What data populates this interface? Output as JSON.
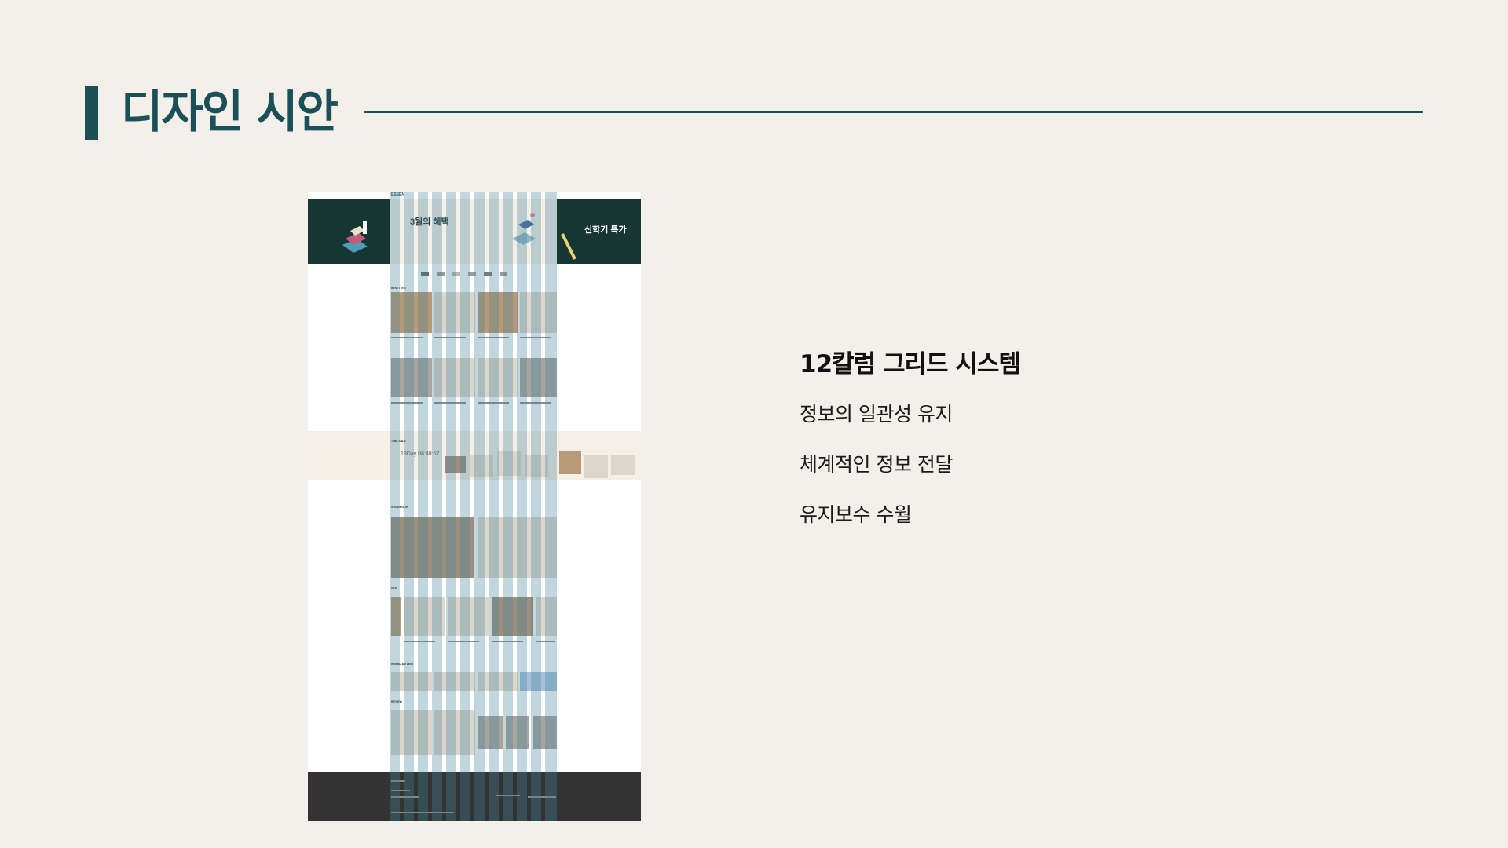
{
  "slide": {
    "title": "디자인 시안",
    "accent_color": "#1c5058",
    "background_color": "#f3f0ea"
  },
  "description": {
    "heading": "12칼럼 그리드 시스템",
    "items": [
      "정보의 일관성 유지",
      "체계적인 정보 전달",
      "유지보수 수월"
    ]
  },
  "mockup": {
    "logo": "ESSEN",
    "hero_left_text": "3월의 혜택",
    "hero_right_text": "신학기 특가",
    "grid_columns": 12,
    "overlay_color": "rgba(70,130,155,0.33)",
    "section_labels": [
      "BEST ITEM",
      "TIME SALE",
      "SHOWROOM",
      "NEW",
      "BRAND & EVENT",
      "REVIEW"
    ],
    "timer_text": "18Day 06:48:57"
  }
}
